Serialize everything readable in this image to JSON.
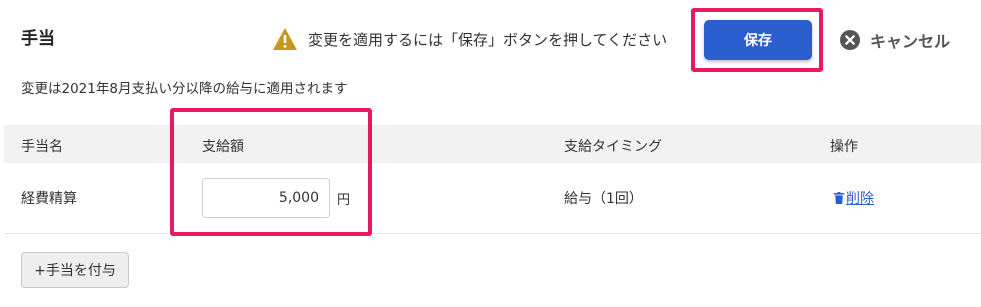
{
  "header": {
    "title": "手当",
    "warning_text": "変更を適用するには「保存」ボタンを押してください",
    "save_label": "保存",
    "cancel_label": "キャンセル"
  },
  "notice": "変更は2021年8月支払い分以降の給与に適用されます",
  "table": {
    "columns": [
      "手当名",
      "支給額",
      "支給タイミング",
      "操作"
    ],
    "rows": [
      {
        "name": "経費精算",
        "amount": "5,000",
        "unit": "円",
        "timing": "給与（1回）",
        "action": "削除"
      }
    ]
  },
  "add_button_label": "+手当を付与",
  "colors": {
    "primary": "#2b5fcf",
    "highlight": "#e8195c",
    "warning": "#c8961a",
    "header_bg": "#f2f2f2"
  },
  "icons": [
    "warning-icon",
    "close-circle-icon",
    "trash-icon"
  ]
}
